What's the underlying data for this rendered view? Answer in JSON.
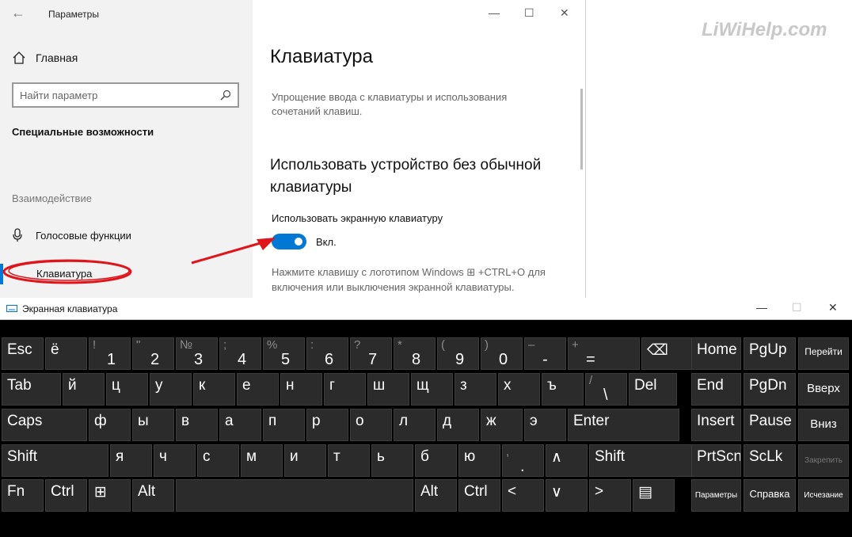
{
  "settings": {
    "app_title": "Параметры",
    "nav_home": "Главная",
    "search_placeholder": "Найти параметр",
    "section_title": "Специальные возможности",
    "group_label": "Взаимодействие",
    "nav_voice": "Голосовые функции",
    "nav_keyboard": "Клавиатура",
    "page_title": "Клавиатура",
    "description": "Упрощение ввода с клавиатуры и использования сочетаний клавиш.",
    "section_heading": "Использовать устройство без обычной клавиатуры",
    "toggle_label": "Использовать экранную клавиатуру",
    "toggle_state": "Вкл.",
    "toggle_on": true,
    "hint": "Нажмите клавишу с логотипом Windows ⊞ +CTRL+O для включения или выключения экранной клавиатуры."
  },
  "watermark": "LiWiHelp.com",
  "osk": {
    "title": "Экранная клавиатура",
    "rows": [
      [
        {
          "main": "Esc"
        },
        {
          "main": "ё"
        },
        {
          "sub": "!",
          "bot": "1"
        },
        {
          "sub": "\"",
          "bot": "2"
        },
        {
          "sub": "№",
          "bot": "3"
        },
        {
          "sub": ";",
          "bot": "4"
        },
        {
          "sub": "%",
          "bot": "5"
        },
        {
          "sub": ":",
          "bot": "6"
        },
        {
          "sub": "?",
          "bot": "7"
        },
        {
          "sub": "*",
          "bot": "8"
        },
        {
          "sub": "(",
          "bot": "9"
        },
        {
          "sub": ")",
          "bot": "0"
        },
        {
          "sub": "–",
          "bot": "-"
        },
        {
          "sub": "+",
          "bot": "="
        },
        {
          "main": "⌫"
        }
      ],
      [
        {
          "main": "Tab"
        },
        {
          "main": "й"
        },
        {
          "main": "ц"
        },
        {
          "main": "у"
        },
        {
          "main": "к"
        },
        {
          "main": "е"
        },
        {
          "main": "н"
        },
        {
          "main": "г"
        },
        {
          "main": "ш"
        },
        {
          "main": "щ"
        },
        {
          "main": "з"
        },
        {
          "main": "х"
        },
        {
          "main": "ъ"
        },
        {
          "sub": "/",
          "bot": "\\"
        },
        {
          "main": "Del"
        }
      ],
      [
        {
          "main": "Caps"
        },
        {
          "main": "ф"
        },
        {
          "main": "ы"
        },
        {
          "main": "в"
        },
        {
          "main": "а"
        },
        {
          "main": "п"
        },
        {
          "main": "р"
        },
        {
          "main": "о"
        },
        {
          "main": "л"
        },
        {
          "main": "д"
        },
        {
          "main": "ж"
        },
        {
          "main": "э"
        },
        {
          "main": "Enter"
        }
      ],
      [
        {
          "main": "Shift"
        },
        {
          "main": "я"
        },
        {
          "main": "ч"
        },
        {
          "main": "с"
        },
        {
          "main": "м"
        },
        {
          "main": "и"
        },
        {
          "main": "т"
        },
        {
          "main": "ь"
        },
        {
          "main": "б"
        },
        {
          "main": "ю"
        },
        {
          "sub": ",",
          "bot": "."
        },
        {
          "main": "∧"
        },
        {
          "main": "Shift"
        }
      ],
      [
        {
          "main": "Fn"
        },
        {
          "main": "Ctrl"
        },
        {
          "main": "⊞"
        },
        {
          "main": "Alt"
        },
        {
          "main": ""
        },
        {
          "main": "Alt"
        },
        {
          "main": "Ctrl"
        },
        {
          "main": "<"
        },
        {
          "main": "∨"
        },
        {
          "main": ">"
        },
        {
          "main": "▤"
        }
      ]
    ],
    "nav_keys": [
      [
        "Home",
        "PgUp",
        "Перейти"
      ],
      [
        "End",
        "PgDn",
        "Вверх"
      ],
      [
        "Insert",
        "Pause",
        "Вниз"
      ],
      [
        "PrtScn",
        "ScLk",
        "Закрепить"
      ],
      [
        "Параметры",
        "Справка",
        "Исчезание"
      ]
    ]
  }
}
